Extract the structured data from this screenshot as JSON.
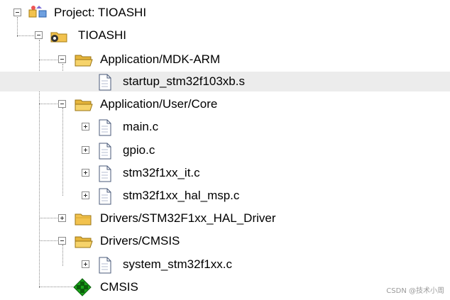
{
  "project_tree": {
    "root": {
      "label": "Project: TIOASHI",
      "icon": "project-icon",
      "state": "expanded"
    },
    "target": {
      "label": "TIOASHI",
      "icon": "target-icon",
      "state": "expanded"
    },
    "groups": [
      {
        "label": "Application/MDK-ARM",
        "icon": "folder-open-icon",
        "state": "expanded",
        "files": [
          {
            "label": "startup_stm32f103xb.s",
            "icon": "file-icon",
            "selected": true
          }
        ]
      },
      {
        "label": "Application/User/Core",
        "icon": "folder-open-icon",
        "state": "expanded",
        "files": [
          {
            "label": "main.c",
            "icon": "file-icon"
          },
          {
            "label": "gpio.c",
            "icon": "file-icon"
          },
          {
            "label": "stm32f1xx_it.c",
            "icon": "file-icon"
          },
          {
            "label": "stm32f1xx_hal_msp.c",
            "icon": "file-icon"
          }
        ]
      },
      {
        "label": "Drivers/STM32F1xx_HAL_Driver",
        "icon": "folder-closed-icon",
        "state": "collapsed"
      },
      {
        "label": "Drivers/CMSIS",
        "icon": "folder-open-icon",
        "state": "expanded",
        "files": [
          {
            "label": "system_stm32f1xx.c",
            "icon": "file-icon"
          }
        ]
      }
    ],
    "component": {
      "label": "CMSIS",
      "icon": "diamond-component-icon"
    }
  },
  "watermark": "CSDN @技术小周",
  "colors": {
    "selection": "#ececec",
    "folder": "#f2c24e",
    "component": "#1aa41a"
  }
}
